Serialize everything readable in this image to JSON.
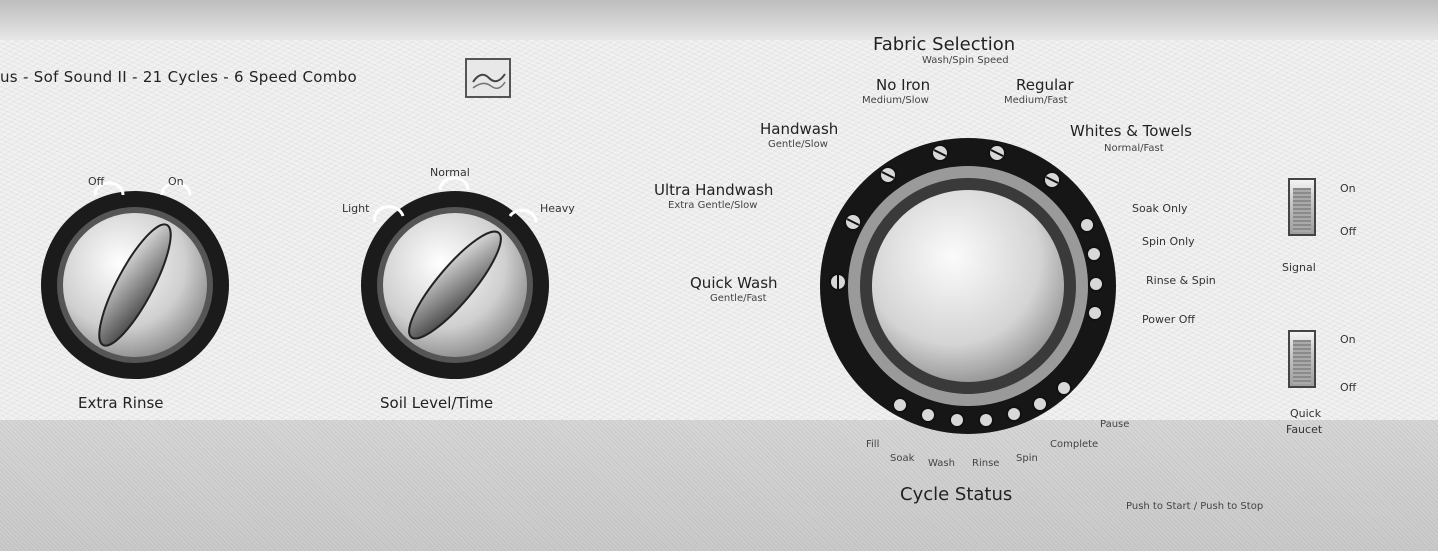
{
  "header": {
    "title": "us - Sof Sound II - 21 Cycles - 6 Speed Combo"
  },
  "extra_rinse": {
    "label": "Extra Rinse",
    "options": [
      "Off",
      "On"
    ]
  },
  "soil_level": {
    "label": "Soil Level/Time",
    "options": [
      "Light",
      "Normal",
      "Heavy"
    ]
  },
  "fabric_selection": {
    "title": "Fabric Selection",
    "subtitle": "Wash/Spin Speed",
    "cycles": [
      {
        "name": "No Iron",
        "speed": "Medium/Slow"
      },
      {
        "name": "Regular",
        "speed": "Medium/Fast"
      },
      {
        "name": "Handwash",
        "speed": "Gentle/Slow"
      },
      {
        "name": "Whites & Towels",
        "speed": "Normal/Fast"
      },
      {
        "name": "Ultra Handwash",
        "speed": "Extra Gentle/Slow"
      },
      {
        "name": "Quick Wash",
        "speed": "Gentle/Fast"
      }
    ],
    "right_options": [
      "Soak Only",
      "Spin Only",
      "Rinse & Spin",
      "Power Off"
    ]
  },
  "cycle_status": {
    "title": "Cycle Status",
    "stages": [
      "Fill",
      "Soak",
      "Wash",
      "Rinse",
      "Spin",
      "Complete",
      "Pause"
    ],
    "push_label": "Push to Start / Push to Stop"
  },
  "signal": {
    "label": "Signal",
    "on": "On",
    "off": "Off"
  },
  "quick_faucet": {
    "label_line1": "Quick",
    "label_line2": "Faucet",
    "on": "On",
    "off": "Off"
  }
}
